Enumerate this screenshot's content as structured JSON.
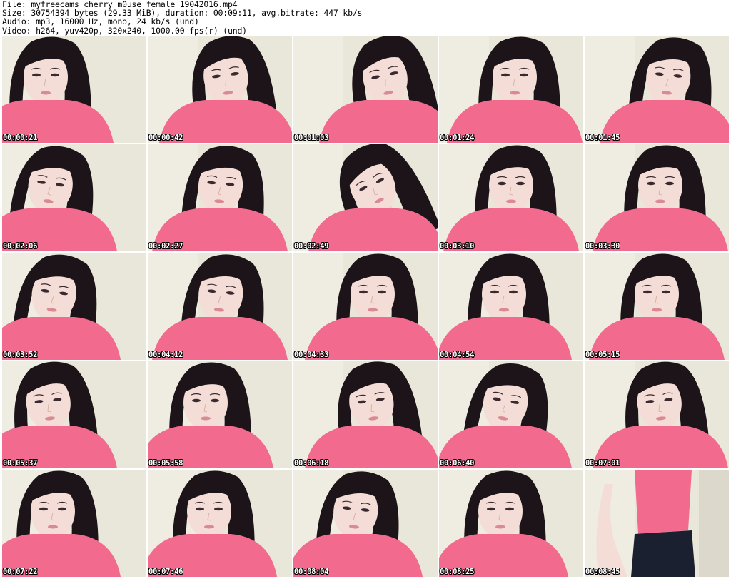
{
  "header": {
    "file_line": "File: myfreecams_cherry_m0use_female_19042016.mp4",
    "size_line": "Size: 30754394 bytes (29.33 MiB), duration: 00:09:11, avg.bitrate: 447 kb/s",
    "audio_line": "Audio: mp3, 16000 Hz, mono, 24 kb/s (und)",
    "video_line": "Video: h264, yuv420p, 320x240, 1000.00 fps(r) (und)"
  },
  "colors": {
    "shirt": "#f26a8e",
    "wall": "#e9e6da",
    "hair": "#1c1418",
    "skin": "#f3ddd6"
  },
  "thumbnails": [
    {
      "timestamp": "00:00:21"
    },
    {
      "timestamp": "00:00:42"
    },
    {
      "timestamp": "00:01:03"
    },
    {
      "timestamp": "00:01:24"
    },
    {
      "timestamp": "00:01:45"
    },
    {
      "timestamp": "00:02:06"
    },
    {
      "timestamp": "00:02:27"
    },
    {
      "timestamp": "00:02:49"
    },
    {
      "timestamp": "00:03:10"
    },
    {
      "timestamp": "00:03:30"
    },
    {
      "timestamp": "00:03:52"
    },
    {
      "timestamp": "00:04:12"
    },
    {
      "timestamp": "00:04:33"
    },
    {
      "timestamp": "00:04:54"
    },
    {
      "timestamp": "00:05:15"
    },
    {
      "timestamp": "00:05:37"
    },
    {
      "timestamp": "00:05:58"
    },
    {
      "timestamp": "00:06:18"
    },
    {
      "timestamp": "00:06:40"
    },
    {
      "timestamp": "00:07:01"
    },
    {
      "timestamp": "00:07:22"
    },
    {
      "timestamp": "00:07:46"
    },
    {
      "timestamp": "00:08:04"
    },
    {
      "timestamp": "00:08:25"
    },
    {
      "timestamp": "00:08:45"
    }
  ]
}
